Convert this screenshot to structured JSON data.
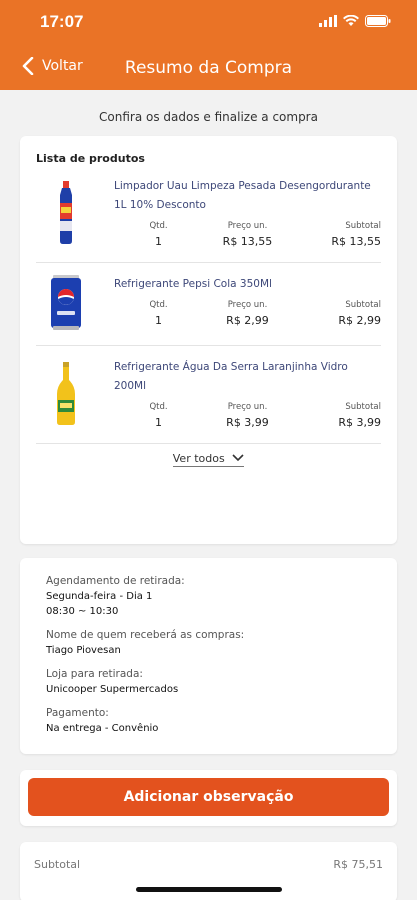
{
  "status_bar": {
    "time": "17:07"
  },
  "nav": {
    "back_label": "Voltar",
    "title": "Resumo da Compra"
  },
  "subtitle": "Confira os dados e finalize a compra",
  "products": {
    "heading": "Lista de produtos",
    "col_qty": "Qtd.",
    "col_price": "Preço un.",
    "col_subtotal": "Subtotal",
    "items": [
      {
        "name": "Limpador Uau Limpeza Pesada Desengordurante 1L 10% Desconto",
        "qty": "1",
        "price": "R$ 13,55",
        "subtotal": "R$ 13,55"
      },
      {
        "name": "Refrigerante Pepsi Cola 350Ml",
        "qty": "1",
        "price": "R$ 2,99",
        "subtotal": "R$ 2,99"
      },
      {
        "name": "Refrigerante Água Da Serra Laranjinha Vidro 200Ml",
        "qty": "1",
        "price": "R$ 3,99",
        "subtotal": "R$ 3,99"
      }
    ],
    "see_all": "Ver todos"
  },
  "details": {
    "schedule_label": "Agendamento de retirada:",
    "schedule_day": "Segunda-feira - Dia 1",
    "schedule_time": "08:30 ~ 10:30",
    "receiver_label": "Nome de quem receberá as compras:",
    "receiver": "Tiago Piovesan",
    "store_label": "Loja para retirada:",
    "store": "Unicooper Supermercados",
    "payment_label": "Pagamento:",
    "payment": "Na entrega - Convênio"
  },
  "observation_button": "Adicionar observação",
  "summary": {
    "subtotal_label": "Subtotal",
    "subtotal_value": "R$ 75,51"
  },
  "colors": {
    "header": "#ea7326",
    "button": "#e3521e",
    "product_name": "#3d4778"
  }
}
